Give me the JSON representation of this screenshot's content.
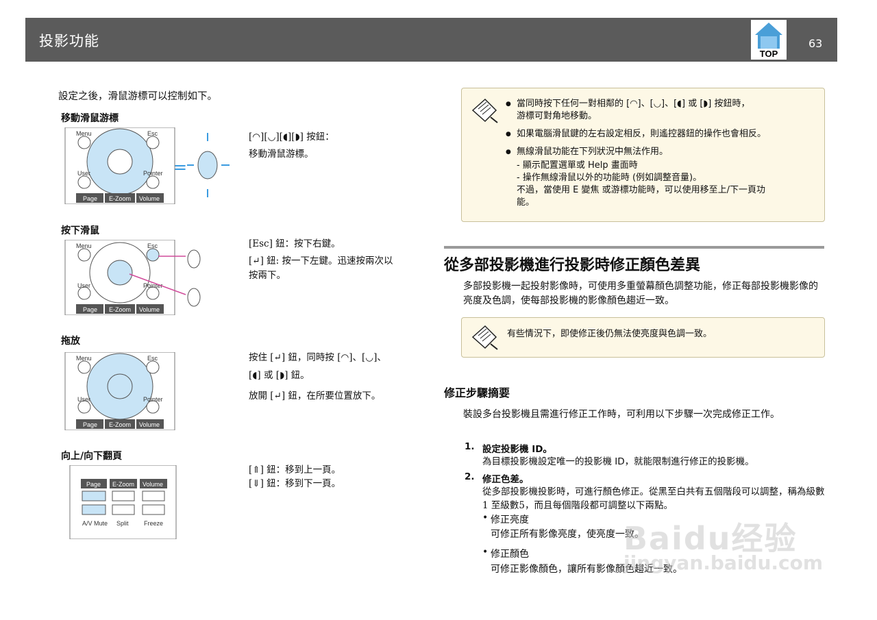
{
  "header": {
    "title": "投影功能",
    "page_number": "63",
    "logo_text": "TOP"
  },
  "left": {
    "intro": "設定之後，滑鼠游標可以控制如下。",
    "sections": [
      {
        "heading": "移動滑鼠游標",
        "lines": [
          "[◠][◡][◖][◗] 按鈕：",
          "移動滑鼠游標。"
        ]
      },
      {
        "heading": "按下滑鼠",
        "lines": [
          "[Esc] 鈕：按下右鍵。",
          "[↵] 鈕: 按一下左鍵。迅速按兩次以",
          "按兩下。"
        ]
      },
      {
        "heading": "拖放",
        "lines": [
          "按住 [↵] 鈕，同時按 [◠]、[◡]、",
          "[◖] 或 [◗] 鈕。",
          "放開 [↵] 鈕，在所要位置放下。"
        ]
      },
      {
        "heading": "向上/向下翻頁",
        "lines": [
          "[⇑] 鈕：移到上一頁。",
          "[⇓] 鈕：移到下一頁。"
        ]
      }
    ],
    "remote_labels": {
      "menu": "Menu",
      "esc": "Esc",
      "user": "User",
      "pointer": "Pointer",
      "page": "Page",
      "ezoom": "E-Zoom",
      "volume": "Volume",
      "av_mute": "A/V Mute",
      "split": "Split",
      "freeze": "Freeze"
    }
  },
  "note1": {
    "items": [
      "當同時按下任何一對相鄰的 [◠]、[◡]、[◖] 或 [◗] 按鈕時，",
      "游標可對角地移動。",
      "如果電腦滑鼠鍵的左右設定相反，則遙控器鈕的操作也會相反。",
      "無線滑鼠功能在下列狀況中無法作用。",
      "- 顯示配置選單或 Help 畫面時",
      "- 操作無線滑鼠以外的功能時 (例如調整音量)。",
      "不過，當使用 E 變焦 或游標功能時，可以使用移至上/下一頁功",
      "能。"
    ]
  },
  "section": {
    "title": "從多部投影機進行投影時修正顏色差異",
    "paragraph": "多部投影機一起投射影像時，可使用多重螢幕顏色調整功能，修正每部投影機影像的亮度及色調，使每部投影機的影像顏色趨近一致。",
    "note": "有些情況下，即使修正後仍無法使亮度與色調一致。",
    "subsection_title": "修正步驟摘要",
    "subsection_paragraph": "裝設多台投影機且需進行修正工作時，可利用以下步驟一次完成修正工作。",
    "steps": [
      {
        "num": "1.",
        "title": "設定投影機 ID。",
        "body": "為目標投影機設定唯一的投影機 ID，就能限制進行修正的投影機。"
      },
      {
        "num": "2.",
        "title": "修正色差。",
        "body": "從多部投影機投影時，可進行顏色修正。從黑至白共有五個階段可以調整，稱為級數1 至級數5，而且每個階段都可調整以下兩點。"
      }
    ],
    "bullets": [
      {
        "title": "修正亮度",
        "body": "可修正所有影像亮度，使亮度一致。"
      },
      {
        "title": "修正顏色",
        "body": "可修正影像顏色，讓所有影像顏色趨近一致。"
      }
    ]
  },
  "watermark": {
    "line1": "Baidu经验",
    "line2": "jingyan.baidu.com"
  }
}
